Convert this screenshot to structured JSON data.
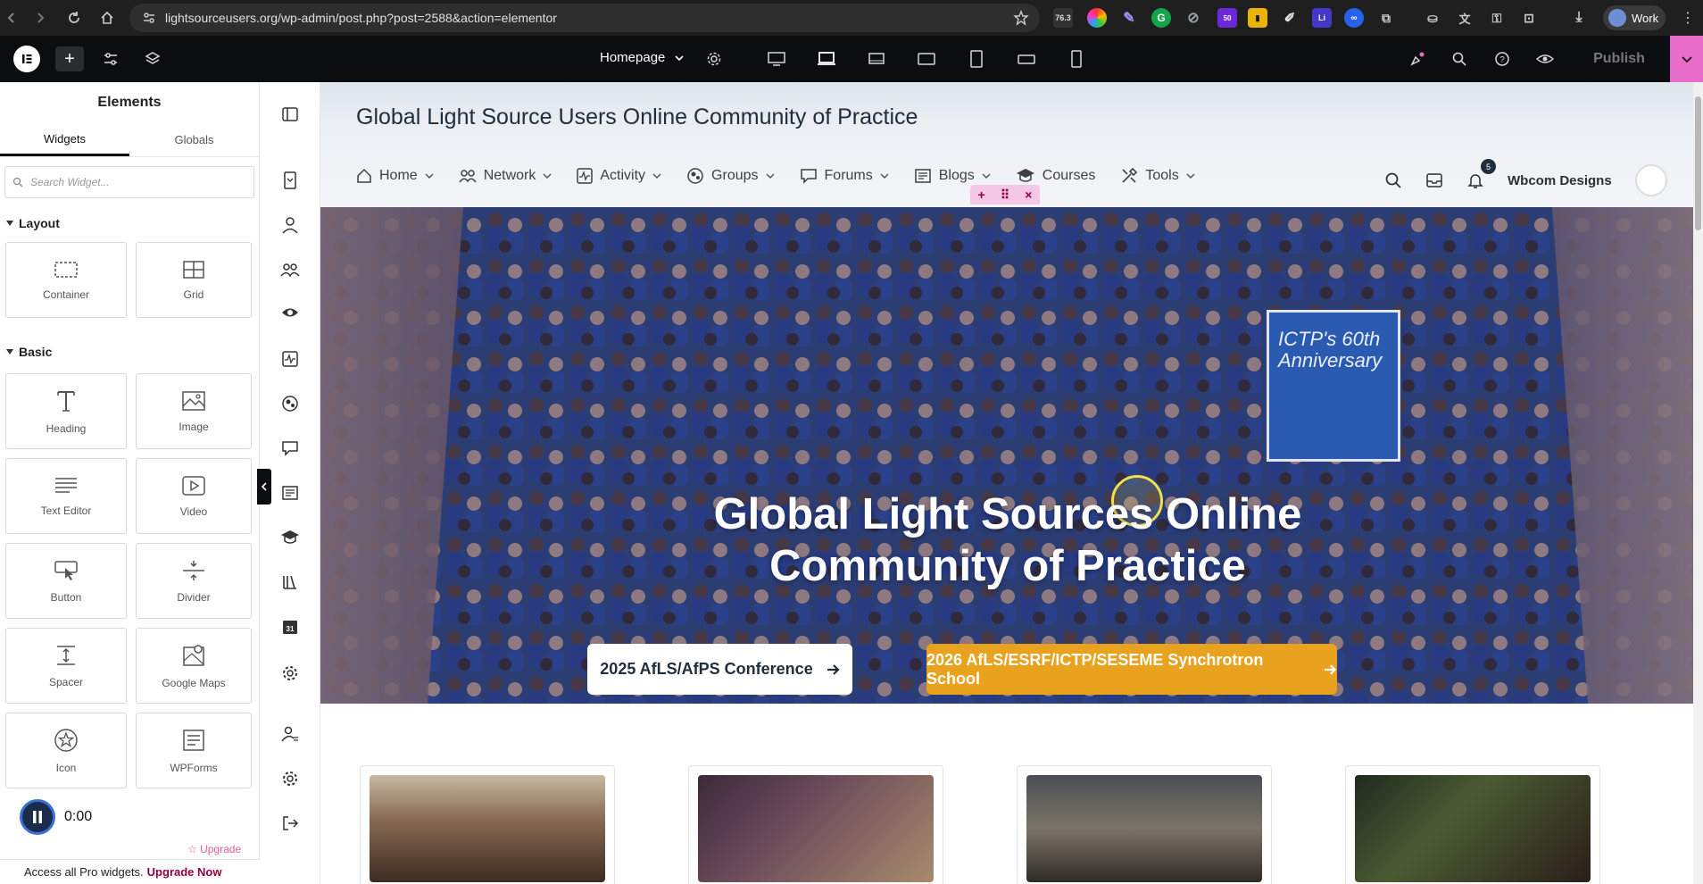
{
  "browser": {
    "url": "lightsourceusers.org/wp-admin/post.php?post=2588&action=elementor",
    "profile_label": "Work",
    "ext_badge": "76.3",
    "ext_badge2": "50"
  },
  "topbar": {
    "page_selector": "Homepage",
    "publish_label": "Publish"
  },
  "panel": {
    "title": "Elements",
    "tabs": [
      "Widgets",
      "Globals"
    ],
    "search_placeholder": "Search Widget...",
    "categories": [
      {
        "label": "Layout",
        "widgets": [
          {
            "label": "Container",
            "icon": "container-icon"
          },
          {
            "label": "Grid",
            "icon": "grid-icon"
          }
        ]
      },
      {
        "label": "Basic",
        "widgets": [
          {
            "label": "Heading",
            "icon": "heading-icon"
          },
          {
            "label": "Image",
            "icon": "image-icon"
          },
          {
            "label": "Text Editor",
            "icon": "text-editor-icon"
          },
          {
            "label": "Video",
            "icon": "video-icon"
          },
          {
            "label": "Button",
            "icon": "button-icon"
          },
          {
            "label": "Divider",
            "icon": "divider-icon"
          },
          {
            "label": "Spacer",
            "icon": "spacer-icon"
          },
          {
            "label": "Google Maps",
            "icon": "map-icon"
          },
          {
            "label": "Icon",
            "icon": "star-icon"
          },
          {
            "label": "WPForms",
            "icon": "wpforms-icon"
          }
        ]
      }
    ],
    "upgrade_link": "Upgrade",
    "pro_text": "Access all Pro widgets.",
    "pro_link": "Upgrade Now",
    "player_time": "0:00"
  },
  "site": {
    "title": "Global Light Source Users Online Community of Practice",
    "menu": [
      {
        "label": "Home",
        "icon": "home-icon",
        "dropdown": true
      },
      {
        "label": "Network",
        "icon": "network-icon",
        "dropdown": true
      },
      {
        "label": "Activity",
        "icon": "activity-icon",
        "dropdown": true
      },
      {
        "label": "Groups",
        "icon": "groups-icon",
        "dropdown": true
      },
      {
        "label": "Forums",
        "icon": "forums-icon",
        "dropdown": true
      },
      {
        "label": "Blogs",
        "icon": "blogs-icon",
        "dropdown": true
      },
      {
        "label": "Courses",
        "icon": "courses-icon",
        "dropdown": false
      },
      {
        "label": "Tools",
        "icon": "tools-icon",
        "dropdown": true
      }
    ],
    "notification_count": "5",
    "user_name": "Wbcom Designs"
  },
  "hero": {
    "title": "Global Light Sources Online Community of Practice",
    "banner_text": "ICTP's 60th Anniversary",
    "buttons": [
      {
        "label": "2025 AfLS/AfPS Conference"
      },
      {
        "label": "2026 AfLS/ESRF/ICTP/SESEME Synchrotron School"
      }
    ]
  },
  "colors": {
    "accent_pink": "#e86cc9",
    "hero_button_gold": "#e9a21d",
    "editor_dark": "#0c0d0e"
  }
}
